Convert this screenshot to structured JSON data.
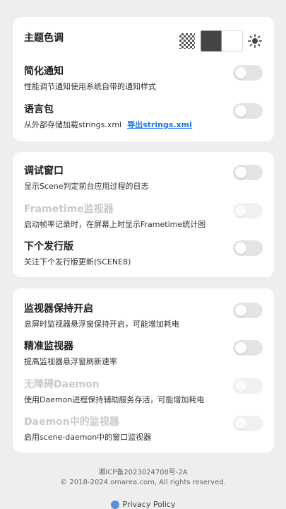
{
  "theme": {
    "title": "主题色调"
  },
  "settings_card1": [
    {
      "title": "简化通知",
      "desc": "性能调节通知使用系统自带的通知样式",
      "enabled": true,
      "on": false
    },
    {
      "title": "语言包",
      "desc": "从外部存储加载strings.xml",
      "link": "导出strings.xml",
      "enabled": true,
      "on": false
    }
  ],
  "settings_card2": [
    {
      "title": "调试窗口",
      "desc": "显示Scene判定前台应用过程的日志",
      "enabled": true,
      "on": false
    },
    {
      "title": "Frametime监视器",
      "desc": "启动帧率记录时，在屏幕上时显示Frametime统计图",
      "enabled": false,
      "on": false
    },
    {
      "title": "下个发行版",
      "desc": "关注下个发行版更新(SCENE8)",
      "enabled": true,
      "on": false
    }
  ],
  "settings_card3": [
    {
      "title": "监视器保持开启",
      "desc": "息屏时监视器悬浮窗保持开启，可能增加耗电",
      "enabled": true,
      "on": false
    },
    {
      "title": "精准监视器",
      "desc": "提高监视器悬浮窗刷新速率",
      "enabled": true,
      "on": false
    },
    {
      "title": "无障碍Daemon",
      "desc": "使用Daemon进程保持辅助服务存活，可能增加耗电",
      "enabled": false,
      "on": false
    },
    {
      "title": "Daemon中的监视器",
      "desc": "启用scene-daemon中的窗口监视器",
      "enabled": false,
      "on": false
    }
  ],
  "footer": {
    "icp": "湘ICP备2023024708号-2A",
    "copyright": "© 2018-2024 omarea.com, All rights reserved.",
    "privacy": "Privacy Policy"
  },
  "colors": {
    "background": "#eeeeee",
    "card": "#ffffff",
    "link": "#1a73e8",
    "toggle_off": "#e4e4e4"
  }
}
